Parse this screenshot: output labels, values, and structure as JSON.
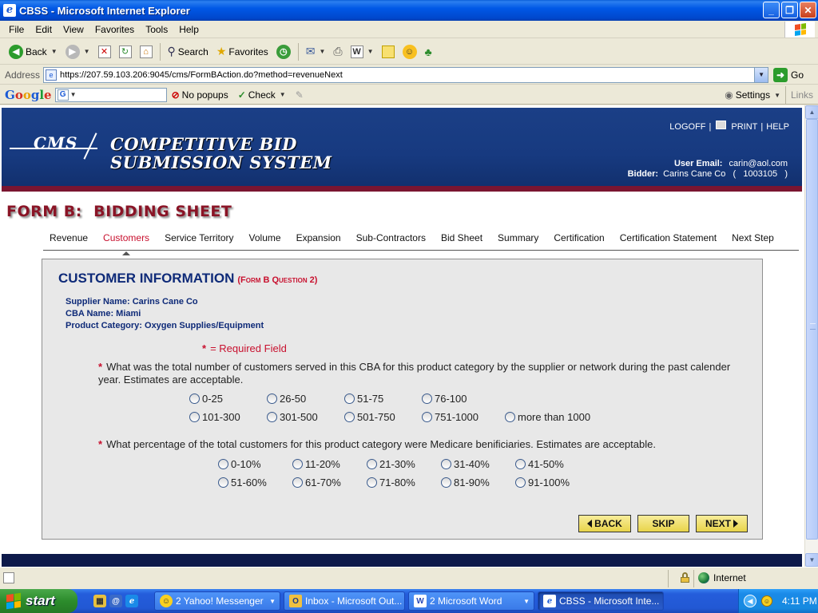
{
  "window": {
    "title": "CBSS - Microsoft Internet Explorer",
    "controls": {
      "minimize": "_",
      "restore": "❐",
      "close": "✕"
    }
  },
  "menu": [
    "File",
    "Edit",
    "View",
    "Favorites",
    "Tools",
    "Help"
  ],
  "toolbar": {
    "back_label": "Back",
    "search_label": "Search",
    "favorites_label": "Favorites"
  },
  "address": {
    "label": "Address",
    "url": "https://207.59.103.206:9045/cms/FormBAction.do?method=revenueNext",
    "go_label": "Go"
  },
  "google_toolbar": {
    "logo": [
      "G",
      "o",
      "o",
      "g",
      "l",
      "e"
    ],
    "popups_label": "No popups",
    "check_label": "Check",
    "settings_label": "Settings",
    "links_label": "Links"
  },
  "header": {
    "logo_text": "CMS",
    "site_title_line1": "COMPETITIVE BID",
    "site_title_line2": "SUBMISSION SYSTEM",
    "logoff": "LOGOFF",
    "print": "PRINT",
    "help": "HELP",
    "sep": "|",
    "user_email_label": "User Email:",
    "user_email": "carin@aol.com",
    "bidder_label": "Bidder:",
    "bidder": "Carins Cane Co   (   1003105   )"
  },
  "form_title": "FORM B:  BIDDING SHEET",
  "tabs": [
    "Revenue",
    "Customers",
    "Service Territory",
    "Volume",
    "Expansion",
    "Sub-Contractors",
    "Bid Sheet",
    "Summary",
    "Certification",
    "Certification Statement",
    "Next Step"
  ],
  "active_tab": "Customers",
  "panel": {
    "title": "CUSTOMER INFORMATION",
    "subtitle": "(Form B Question 2)",
    "supplier_name": "Supplier Name: Carins Cane Co",
    "cba_name": "CBA Name: Miami",
    "product_category": "Product Category: Oxygen Supplies/Equipment",
    "required_legend": "= Required Field",
    "star": "*",
    "question1": "What was the total number of customers served in this CBA for this product category by the supplier or network during the past calender year. Estimates are acceptable.",
    "q1_options": [
      "0-25",
      "26-50",
      "51-75",
      "76-100",
      "101-300",
      "301-500",
      "501-750",
      "751-1000",
      "more than 1000"
    ],
    "question2": "What percentage of the total customers for this product category were Medicare benificiaries. Estimates are acceptable.",
    "q2_options": [
      "0-10%",
      "11-20%",
      "21-30%",
      "31-40%",
      "41-50%",
      "51-60%",
      "61-70%",
      "71-80%",
      "81-90%",
      "91-100%"
    ],
    "back_label": "BACK",
    "skip_label": "SKIP",
    "next_label": "NEXT"
  },
  "status": {
    "zone": "Internet"
  },
  "taskbar": {
    "start_label": "start",
    "tasks": [
      {
        "label": "2 Yahoo! Messenger",
        "icon": "yahoo-messenger-icon",
        "color": "#f8d020"
      },
      {
        "label": "Inbox - Microsoft Out...",
        "icon": "outlook-icon",
        "color": "#f0c040"
      },
      {
        "label": "2 Microsoft Word",
        "icon": "word-icon",
        "color": "#2a4ab8"
      },
      {
        "label": "CBSS - Microsoft Inte...",
        "icon": "ie-icon",
        "color": "#3a8ae8"
      }
    ],
    "clock": "4:11 PM"
  }
}
